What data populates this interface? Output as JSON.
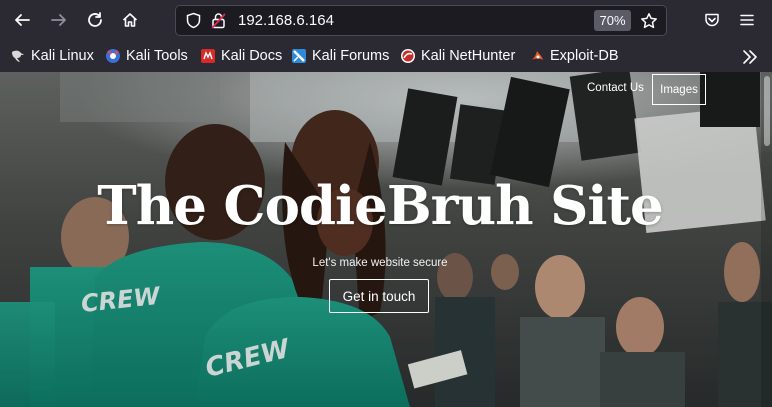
{
  "browser": {
    "url": "192.168.6.164",
    "zoom": "70%"
  },
  "bookmarks": [
    {
      "label": "Kali Linux",
      "icon": "kali-dragon-icon"
    },
    {
      "label": "Kali Tools",
      "icon": "kali-tools-icon"
    },
    {
      "label": "Kali Docs",
      "icon": "kali-docs-icon"
    },
    {
      "label": "Kali Forums",
      "icon": "kali-forums-icon"
    },
    {
      "label": "Kali NetHunter",
      "icon": "kali-nethunter-icon"
    },
    {
      "label": "Exploit-DB",
      "icon": "exploit-db-icon"
    }
  ],
  "site": {
    "nav": {
      "contact": "Contact Us",
      "images": "Images"
    },
    "title": "The CodieBruh Site",
    "subtitle": "Let's make website secure",
    "cta": "Get in touch"
  },
  "colors": {
    "chrome_bg": "#2b2a33",
    "urlbar_bg": "#1c1b22",
    "shirt_teal": "#1a9c84"
  }
}
